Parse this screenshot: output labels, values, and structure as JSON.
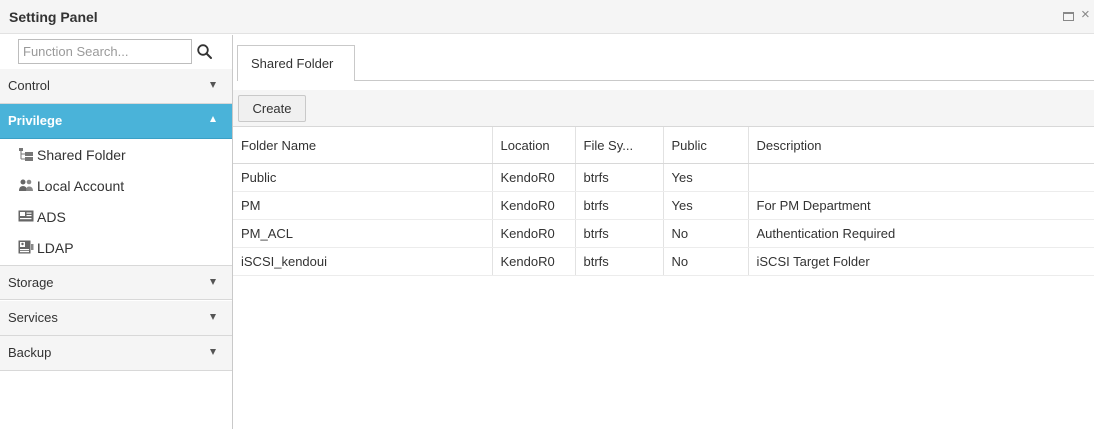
{
  "window": {
    "title": "Setting Panel",
    "maximize_icon": "maximize-icon",
    "close_icon": "close-icon"
  },
  "sidebar": {
    "search": {
      "placeholder": "Function Search...",
      "value": "",
      "icon": "search-icon"
    },
    "sections": [
      {
        "label": "Control",
        "expanded": false
      },
      {
        "label": "Privilege",
        "expanded": true
      },
      {
        "label": "Storage",
        "expanded": false
      },
      {
        "label": "Services",
        "expanded": false
      },
      {
        "label": "Backup",
        "expanded": false
      }
    ],
    "privilege_items": [
      {
        "label": "Shared Folder",
        "icon": "folder-tree-icon"
      },
      {
        "label": "Local Account",
        "icon": "users-icon"
      },
      {
        "label": "ADS",
        "icon": "ads-icon"
      },
      {
        "label": "LDAP",
        "icon": "ldap-icon"
      }
    ]
  },
  "tabs": [
    {
      "label": "Shared Folder",
      "active": true
    }
  ],
  "toolbar": {
    "create_label": "Create"
  },
  "grid": {
    "columns": [
      "Folder Name",
      "Location",
      "File Sy...",
      "Public",
      "Description"
    ],
    "rows": [
      [
        "Public",
        "KendoR0",
        "btrfs",
        "Yes",
        ""
      ],
      [
        "PM",
        "KendoR0",
        "btrfs",
        "Yes",
        "For PM Department"
      ],
      [
        "PM_ACL",
        "KendoR0",
        "btrfs",
        "No",
        "Authentication Required"
      ],
      [
        "iSCSI_kendoui",
        "KendoR0",
        "btrfs",
        "No",
        "iSCSI Target Folder"
      ]
    ]
  },
  "colors": {
    "accent": "#4ab3d9",
    "panel_bg": "#f5f5f5",
    "border": "#c9c9c9"
  }
}
